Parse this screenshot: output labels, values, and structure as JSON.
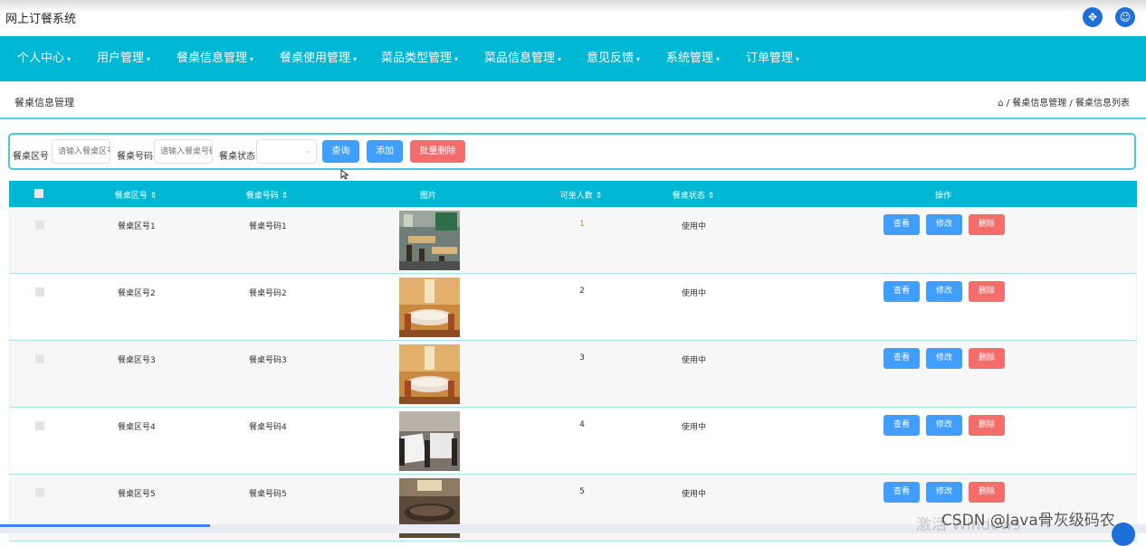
{
  "app": {
    "title": "网上订餐系统",
    "icons": [
      "fullscreen-icon",
      "user-icon"
    ]
  },
  "nav": {
    "items": [
      {
        "label": "个人中心"
      },
      {
        "label": "用户管理"
      },
      {
        "label": "餐桌信息管理"
      },
      {
        "label": "餐桌使用管理"
      },
      {
        "label": "菜品类型管理"
      },
      {
        "label": "菜品信息管理"
      },
      {
        "label": "意见反馈"
      },
      {
        "label": "系统管理"
      },
      {
        "label": "订单管理"
      }
    ],
    "caret": "▾"
  },
  "header": {
    "page_title": "餐桌信息管理",
    "breadcrumb": "⌂ / 餐桌信息管理 / 餐桌信息列表"
  },
  "filter": {
    "area_label": "餐桌区号",
    "area_placeholder": "请输入餐桌区号",
    "number_label": "餐桌号码",
    "number_placeholder": "请输入餐桌号码",
    "status_label": "餐桌状态",
    "status_value": "",
    "query_label": "查询",
    "add_label": "添加",
    "batch_delete_label": "批量删除"
  },
  "table": {
    "columns": [
      "餐桌区号 ⇕",
      "餐桌号码 ⇕",
      "图片",
      "可坐人数 ⇕",
      "餐桌状态 ⇕",
      "操作"
    ],
    "rows": [
      {
        "area": "餐桌区号1",
        "number": "餐桌号码1",
        "image": "restaurant-green",
        "seats": "1",
        "status": "使用中"
      },
      {
        "area": "餐桌区号2",
        "number": "餐桌号码2",
        "image": "banquet-round",
        "seats": "2",
        "status": "使用中"
      },
      {
        "area": "餐桌区号3",
        "number": "餐桌号码3",
        "image": "banquet-round",
        "seats": "3",
        "status": "使用中"
      },
      {
        "area": "餐桌区号4",
        "number": "餐桌号码4",
        "image": "dining-hall",
        "seats": "4",
        "status": "使用中"
      },
      {
        "area": "餐桌区号5",
        "number": "餐桌号码5",
        "image": "private-room",
        "seats": "5",
        "status": "使用中"
      }
    ],
    "row_actions": {
      "view": "查看",
      "edit": "修改",
      "delete": "删除"
    }
  },
  "overlay": {
    "watermark": "激活 Windows",
    "csdn": "CSDN @Java骨灰级码农"
  },
  "colors": {
    "primary": "#00b7d4",
    "button_blue": "#409eff",
    "button_red": "#f56c6c"
  }
}
